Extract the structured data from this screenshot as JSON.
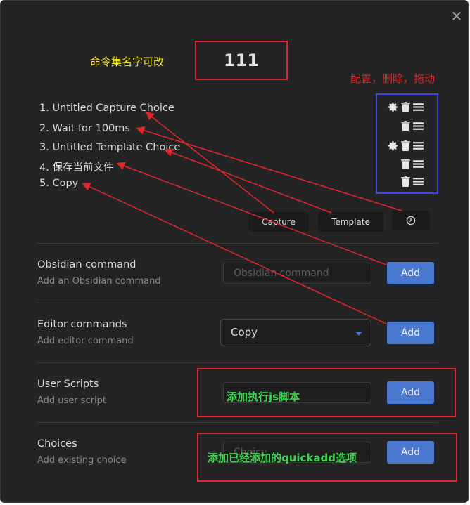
{
  "close_symbol": "✕",
  "macro_name": "111",
  "annotations": {
    "rename": "命令集名字可改",
    "controls": "配置，删除，拖动",
    "user_script": "添加执行js脚本",
    "choices": "添加已经添加的quickadd选项"
  },
  "commands": [
    {
      "label": "1. Untitled Capture Choice",
      "has_settings": true
    },
    {
      "label": "2. Wait for 100ms",
      "has_settings": false
    },
    {
      "label": "3. Untitled Template Choice",
      "has_settings": true
    },
    {
      "label": "4. 保存当前文件",
      "has_settings": false
    },
    {
      "label": "5. Copy",
      "has_settings": false
    }
  ],
  "chips": {
    "capture": "Capture",
    "template": "Template",
    "wait_icon": "clock-icon"
  },
  "settings": {
    "obsidian": {
      "name": "Obsidian command",
      "desc": "Add an Obsidian command",
      "placeholder": "Obsidian command",
      "button": "Add"
    },
    "editor": {
      "name": "Editor commands",
      "desc": "Add editor command",
      "selected": "Copy",
      "button": "Add"
    },
    "user_scripts": {
      "name": "User Scripts",
      "desc": "Add user script",
      "button": "Add"
    },
    "choices": {
      "name": "Choices",
      "desc": "Add existing choice",
      "placeholder": "Choice",
      "button": "Add"
    }
  },
  "colors": {
    "accent": "#4a78d1",
    "annotation_red": "#e0262b",
    "annotation_blue": "#3c48d6",
    "annotation_yellow": "#f6e51c",
    "annotation_green": "#3cd64e"
  }
}
